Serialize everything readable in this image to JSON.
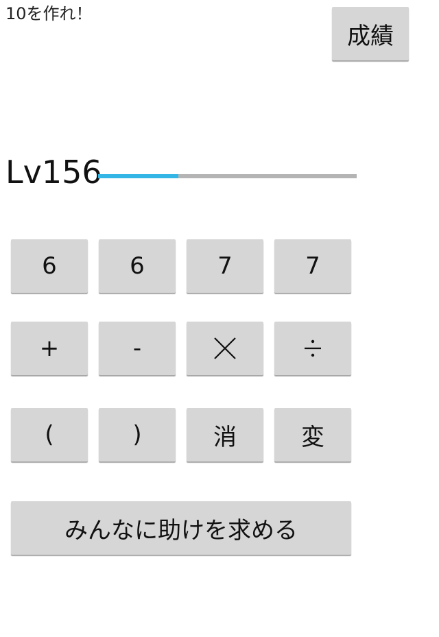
{
  "header": {
    "title": "10を作れ！",
    "score_label": "成績"
  },
  "level": {
    "label": "Lv156",
    "progress": 0.31,
    "progress_color": "#33b5e5",
    "track_color": "#b4b4b4"
  },
  "numbers": [
    "6",
    "6",
    "7",
    "7"
  ],
  "operators": {
    "plus": "+",
    "minus": "-",
    "times_icon": "multiply-icon",
    "divide_icon": "divide-icon"
  },
  "controls": {
    "open_paren": "(",
    "close_paren": ")",
    "delete": "消",
    "change": "変"
  },
  "help_label": "みんなに助けを求める",
  "colors": {
    "button_bg": "#d6d6d6",
    "background": "#ffffff"
  }
}
